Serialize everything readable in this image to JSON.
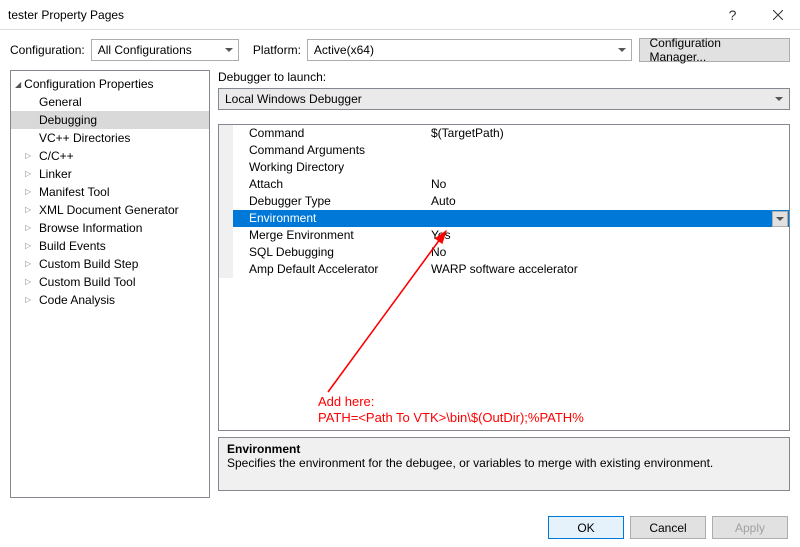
{
  "window": {
    "title": "tester Property Pages"
  },
  "toolbar": {
    "config_label": "Configuration:",
    "config_value": "All Configurations",
    "platform_label": "Platform:",
    "platform_value": "Active(x64)",
    "config_mgr": "Configuration Manager..."
  },
  "tree": {
    "root": "Configuration Properties",
    "items": [
      "General",
      "Debugging",
      "VC++ Directories",
      "C/C++",
      "Linker",
      "Manifest Tool",
      "XML Document Generator",
      "Browse Information",
      "Build Events",
      "Custom Build Step",
      "Custom Build Tool",
      "Code Analysis"
    ],
    "selected": "Debugging",
    "expandable": [
      "C/C++",
      "Linker",
      "Manifest Tool",
      "XML Document Generator",
      "Browse Information",
      "Build Events",
      "Custom Build Step",
      "Custom Build Tool",
      "Code Analysis"
    ]
  },
  "debugger": {
    "launch_label": "Debugger to launch:",
    "launch_value": "Local Windows Debugger"
  },
  "props": [
    {
      "k": "Command",
      "v": "$(TargetPath)"
    },
    {
      "k": "Command Arguments",
      "v": ""
    },
    {
      "k": "Working Directory",
      "v": ""
    },
    {
      "k": "Attach",
      "v": "No"
    },
    {
      "k": "Debugger Type",
      "v": "Auto"
    },
    {
      "k": "Environment",
      "v": "",
      "selected": true
    },
    {
      "k": "Merge Environment",
      "v": "Yes"
    },
    {
      "k": "SQL Debugging",
      "v": "No"
    },
    {
      "k": "Amp Default Accelerator",
      "v": "WARP software accelerator"
    }
  ],
  "desc": {
    "title": "Environment",
    "text": "Specifies the environment for the debugee, or variables to merge with existing environment."
  },
  "buttons": {
    "ok": "OK",
    "cancel": "Cancel",
    "apply": "Apply"
  },
  "annotation": {
    "line1": "Add here:",
    "line2": "PATH=<Path To VTK>\\bin\\$(OutDir);%PATH%"
  }
}
